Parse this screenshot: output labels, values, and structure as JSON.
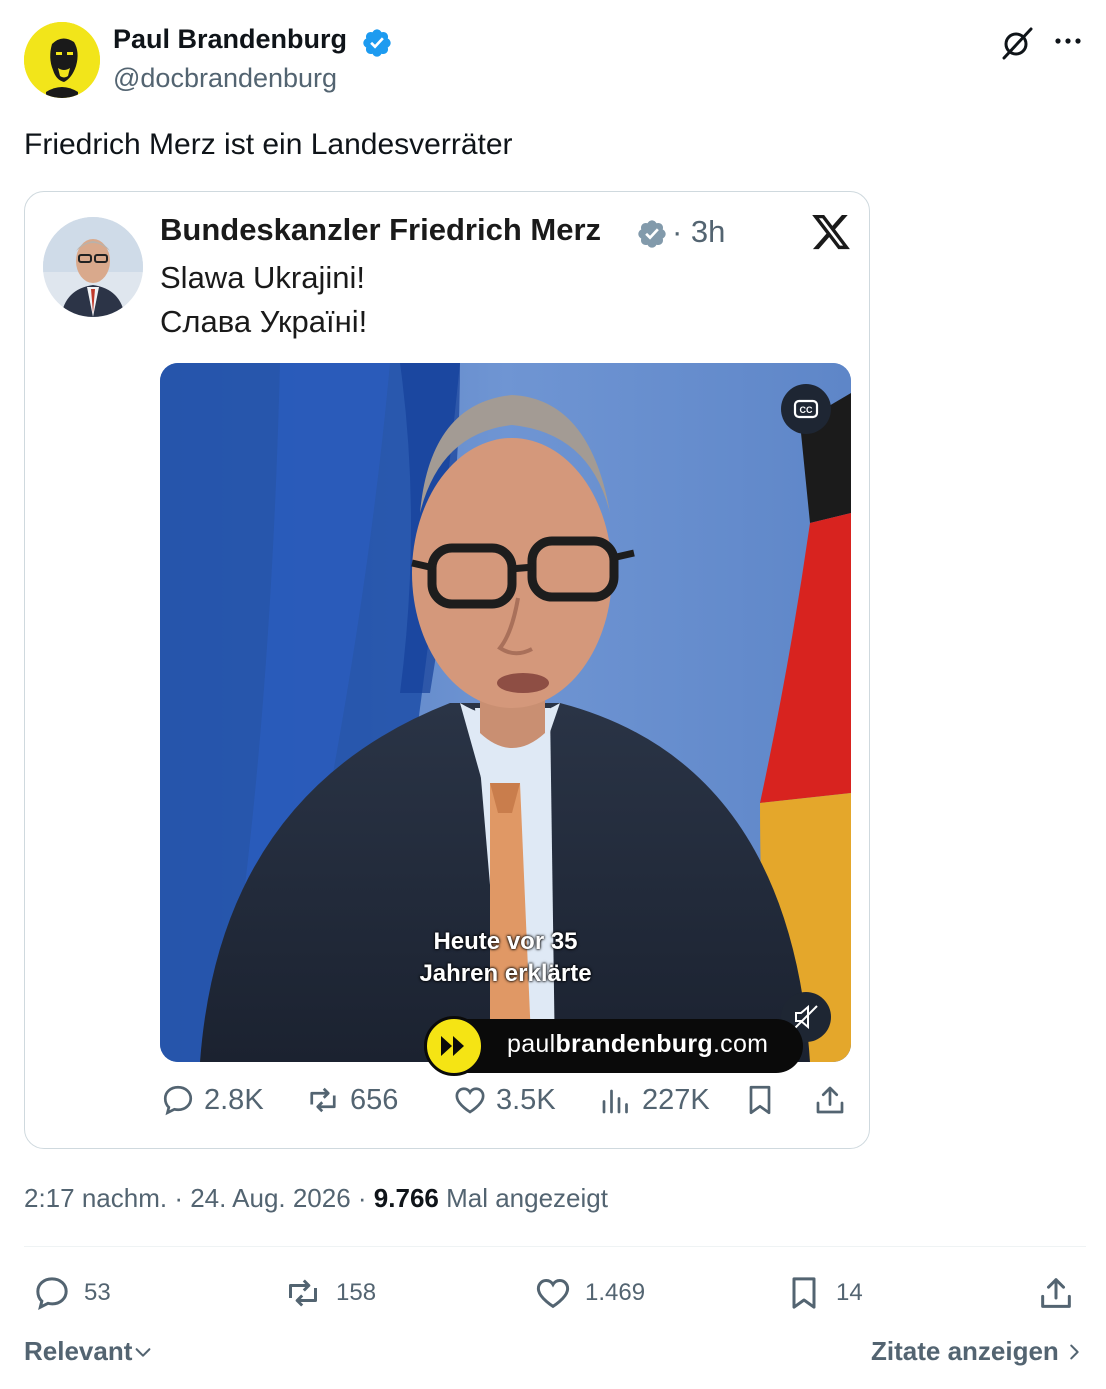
{
  "author": {
    "display_name": "Paul Brandenburg",
    "handle": "@docbrandenburg"
  },
  "tweet": {
    "text": "Friedrich Merz ist ein Landesverräter"
  },
  "embedded_post": {
    "author": "Bundeskanzler Friedrich Merz",
    "time": "· 3h",
    "line1": "Slawa Ukrajini!",
    "line2": "Слава Україні!",
    "subtitle_line1": "Heute vor 35",
    "subtitle_line2": "Jahren erklärte",
    "watermark_prefix": "paul",
    "watermark_bold": "brandenburg",
    "watermark_suffix": ".com",
    "stats": {
      "replies": "2.8K",
      "reposts": "656",
      "likes": "3.5K",
      "views": "227K"
    }
  },
  "meta": {
    "time": "2:17 nachm.",
    "sep1": " · ",
    "date": "24. Aug. 2026",
    "sep2": " · ",
    "views_count": "9.766",
    "views_label": " Mal angezeigt"
  },
  "actions": {
    "replies": "53",
    "reposts": "158",
    "likes": "1.469",
    "bookmarks": "14"
  },
  "footer": {
    "sort_label": "Relevant",
    "quotes_label": "Zitate anzeigen"
  },
  "colors": {
    "verified": "#1d9bf0",
    "text_secondary": "#536471",
    "watermark_yellow": "#f5e414"
  }
}
